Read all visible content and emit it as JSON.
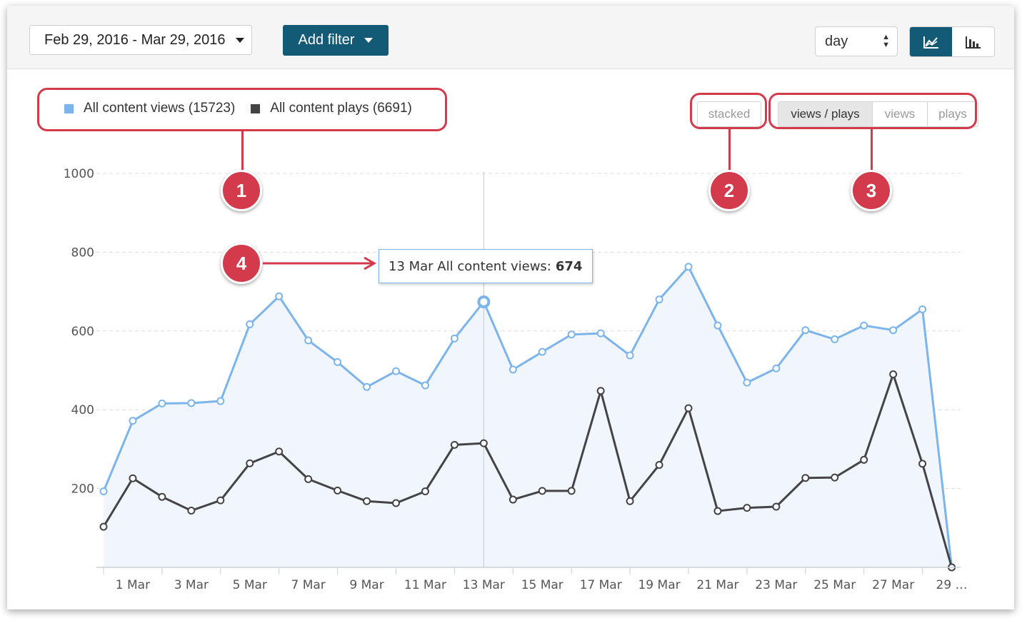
{
  "toolbar": {
    "date_range": "Feb 29, 2016 - Mar 29, 2016",
    "add_filter": "Add filter",
    "interval": "day",
    "area_icon": "area-chart-icon",
    "bar_icon": "bar-chart-icon"
  },
  "legend": [
    {
      "label": "All content views (15723)",
      "color": "#7cb5ec"
    },
    {
      "label": "All content plays (6691)",
      "color": "#434348"
    }
  ],
  "controls": {
    "stacked": "stacked",
    "segments": [
      "views / plays",
      "views",
      "plays"
    ]
  },
  "callouts": [
    "1",
    "2",
    "3",
    "4"
  ],
  "tooltip": {
    "prefix": "13 Mar All content views:",
    "value": "674"
  },
  "chart_data": {
    "type": "area",
    "x": [
      "29 Feb",
      "1 Mar",
      "2 Mar",
      "3 Mar",
      "4 Mar",
      "5 Mar",
      "6 Mar",
      "7 Mar",
      "8 Mar",
      "9 Mar",
      "10 Mar",
      "11 Mar",
      "12 Mar",
      "13 Mar",
      "14 Mar",
      "15 Mar",
      "16 Mar",
      "17 Mar",
      "18 Mar",
      "19 Mar",
      "20 Mar",
      "21 Mar",
      "22 Mar",
      "23 Mar",
      "24 Mar",
      "25 Mar",
      "26 Mar",
      "27 Mar",
      "28 Mar",
      "29 Mar"
    ],
    "tick_labels": [
      "1 Mar",
      "3 Mar",
      "5 Mar",
      "7 Mar",
      "9 Mar",
      "11 Mar",
      "13 Mar",
      "15 Mar",
      "17 Mar",
      "19 Mar",
      "21 Mar",
      "23 Mar",
      "25 Mar",
      "27 Mar",
      "29 …"
    ],
    "y_ticks": [
      "200",
      "400",
      "600",
      "800",
      "1000"
    ],
    "ylim": [
      0,
      1000
    ],
    "grid": true,
    "legend_position": "top-left",
    "series": [
      {
        "name": "All content views",
        "color": "#7cb5ec",
        "values": [
          193,
          372,
          416,
          417,
          422,
          617,
          688,
          576,
          521,
          458,
          498,
          462,
          581,
          674,
          502,
          547,
          591,
          594,
          538,
          680,
          763,
          614,
          469,
          505,
          602,
          579,
          614,
          602,
          655,
          0
        ]
      },
      {
        "name": "All content plays",
        "color": "#434348",
        "values": [
          103,
          226,
          179,
          144,
          170,
          264,
          294,
          224,
          195,
          168,
          163,
          193,
          311,
          315,
          172,
          194,
          194,
          448,
          168,
          260,
          404,
          143,
          151,
          154,
          227,
          228,
          273,
          490,
          263,
          0
        ]
      }
    ]
  }
}
